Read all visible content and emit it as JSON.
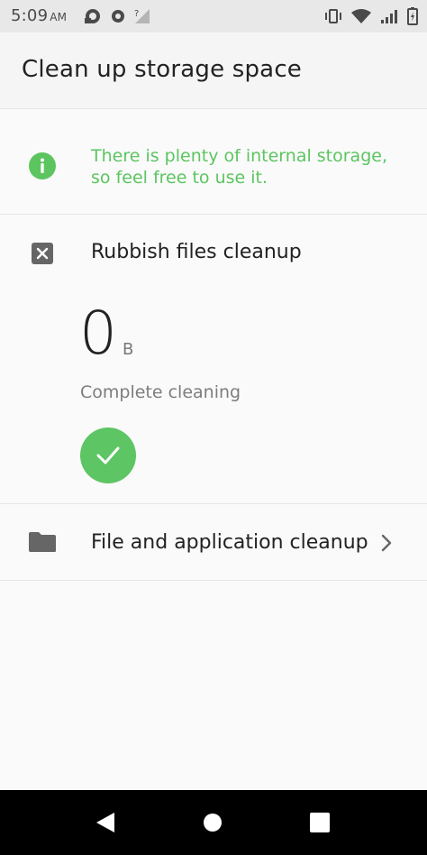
{
  "status_bar": {
    "time": "5:09",
    "ampm": "AM",
    "left_icons": [
      "notification-icon",
      "settings-dot-icon",
      "no-signal-icon"
    ],
    "right_icons": [
      "vibrate-icon",
      "wifi-icon",
      "signal-icon",
      "battery-icon"
    ]
  },
  "header": {
    "title": "Clean up storage space"
  },
  "info": {
    "message": "There is plenty of internal storage, so feel free to use it.",
    "icon": "info-icon",
    "color": "#5cc560"
  },
  "rubbish": {
    "label": "Rubbish files cleanup",
    "icon": "rubbish-bin-icon",
    "size_value": "0",
    "size_unit": "B",
    "status": "Complete cleaning",
    "check_color": "#5dc563"
  },
  "file_app": {
    "label": "File and application cleanup",
    "icon": "folder-icon",
    "chevron": "chevron-right-icon"
  },
  "nav": {
    "buttons": [
      "back-icon",
      "home-icon",
      "recents-icon"
    ]
  }
}
